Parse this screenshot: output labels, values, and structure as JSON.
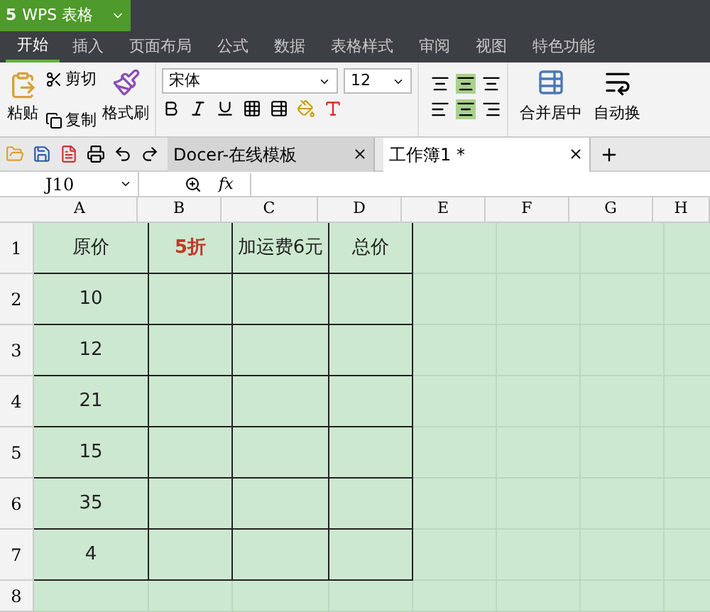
{
  "app_button": {
    "label": "WPS 表格",
    "logo": "5"
  },
  "ribbon_tabs": [
    {
      "label": "开始",
      "selected": true
    },
    {
      "label": "插入",
      "selected": false
    },
    {
      "label": "页面布局",
      "selected": false
    },
    {
      "label": "公式",
      "selected": false
    },
    {
      "label": "数据",
      "selected": false
    },
    {
      "label": "表格样式",
      "selected": false
    },
    {
      "label": "审阅",
      "selected": false
    },
    {
      "label": "视图",
      "selected": false
    },
    {
      "label": "特色功能",
      "selected": false
    }
  ],
  "clipboard": {
    "paste": "粘贴",
    "cut": "剪切",
    "copy": "复制",
    "format_painter": "格式刷"
  },
  "font": {
    "name": "宋体",
    "size": "12"
  },
  "merge": {
    "label": "合并居中"
  },
  "wrap": {
    "label": "自动换"
  },
  "doc_tabs": [
    {
      "label": "Docer-在线模板",
      "selected": false
    },
    {
      "label": "工作簿1 *",
      "selected": true
    }
  ],
  "name_box": {
    "value": "J10"
  },
  "formula_bar": {
    "fx": "fx"
  },
  "columns": [
    "A",
    "B",
    "C",
    "D",
    "E",
    "F",
    "G",
    "H"
  ],
  "rows": [
    {
      "header": "1",
      "cells": [
        {
          "text": "原价",
          "emphasis": false
        },
        {
          "text": "5折",
          "emphasis": true
        },
        {
          "text": "加运费6元",
          "emphasis": false
        },
        {
          "text": "总价",
          "emphasis": false
        }
      ]
    },
    {
      "header": "2",
      "cells": [
        {
          "text": "10",
          "emphasis": false
        }
      ]
    },
    {
      "header": "3",
      "cells": [
        {
          "text": "12",
          "emphasis": false
        }
      ]
    },
    {
      "header": "4",
      "cells": [
        {
          "text": "21",
          "emphasis": false
        }
      ]
    },
    {
      "header": "5",
      "cells": [
        {
          "text": "15",
          "emphasis": false
        }
      ]
    },
    {
      "header": "6",
      "cells": [
        {
          "text": "35",
          "emphasis": false
        }
      ]
    },
    {
      "header": "7",
      "cells": [
        {
          "text": "4",
          "emphasis": false
        }
      ]
    },
    {
      "header": "8",
      "cells": []
    }
  ]
}
